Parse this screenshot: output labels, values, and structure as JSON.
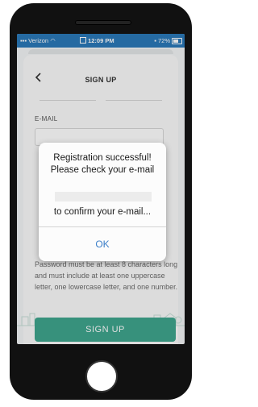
{
  "status_bar": {
    "carrier": "Verizon",
    "time": "12:09 PM",
    "battery": "72%"
  },
  "header": {
    "back_icon": "chevron-left-icon",
    "title": "SIGN UP"
  },
  "form": {
    "email_label": "E-MAIL",
    "password_hint": "Password must be at least 8 characters long and must include at least one uppercase letter, one lowercase letter, and one number.",
    "signup_button": "SIGN UP"
  },
  "dialog": {
    "message": "Registration successful! Please check your e-mail",
    "confirm_text": "to confirm your e-mail...",
    "ok_label": "OK"
  },
  "colors": {
    "status_bar": "#2b79b9",
    "accent": "#3fa58e",
    "link": "#3c7fc9"
  }
}
